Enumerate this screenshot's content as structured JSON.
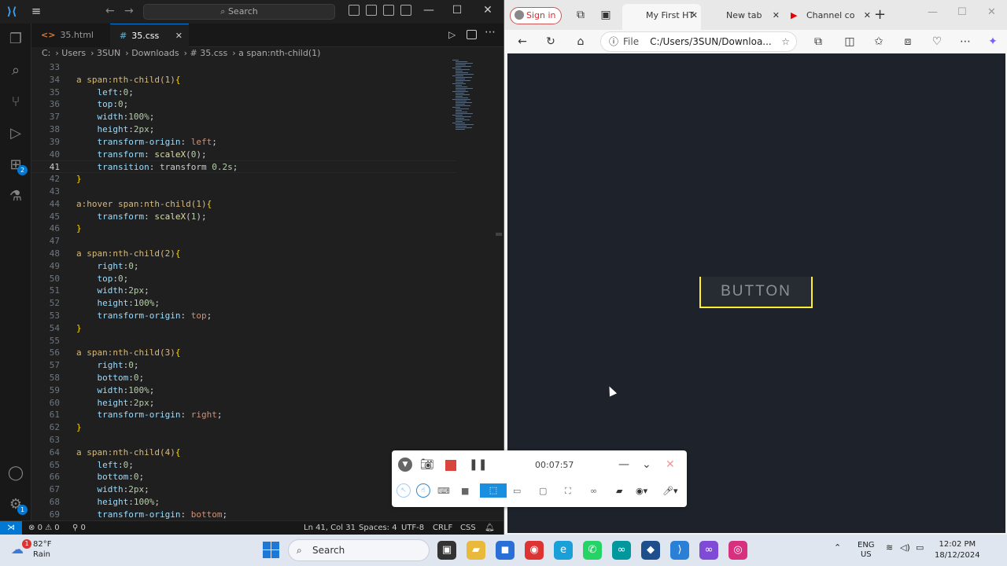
{
  "vscode": {
    "search_placeholder": "Search",
    "tabs": [
      {
        "label": "35.html",
        "icon": "<>"
      },
      {
        "label": "35.css",
        "icon": "#"
      }
    ],
    "breadcrumb": [
      "C:",
      "Users",
      "3SUN",
      "Downloads",
      "# 35.css",
      "a span:nth-child(1)"
    ],
    "lines": [
      {
        "n": "33",
        "t": ""
      },
      {
        "n": "34",
        "t": "a span:nth-child(1){"
      },
      {
        "n": "35",
        "t": "    left:0;"
      },
      {
        "n": "36",
        "t": "    top:0;"
      },
      {
        "n": "37",
        "t": "    width:100%;"
      },
      {
        "n": "38",
        "t": "    height:2px;"
      },
      {
        "n": "39",
        "t": "    transform-origin: left;"
      },
      {
        "n": "40",
        "t": "    transform: scaleX(0);"
      },
      {
        "n": "41",
        "t": "    transition: transform 0.2s;"
      },
      {
        "n": "42",
        "t": "}"
      },
      {
        "n": "43",
        "t": ""
      },
      {
        "n": "44",
        "t": "a:hover span:nth-child(1){"
      },
      {
        "n": "45",
        "t": "    transform: scaleX(1);"
      },
      {
        "n": "46",
        "t": "}"
      },
      {
        "n": "47",
        "t": ""
      },
      {
        "n": "48",
        "t": "a span:nth-child(2){"
      },
      {
        "n": "49",
        "t": "    right:0;"
      },
      {
        "n": "50",
        "t": "    top:0;"
      },
      {
        "n": "51",
        "t": "    width:2px;"
      },
      {
        "n": "52",
        "t": "    height:100%;"
      },
      {
        "n": "53",
        "t": "    transform-origin: top;"
      },
      {
        "n": "54",
        "t": "}"
      },
      {
        "n": "55",
        "t": ""
      },
      {
        "n": "56",
        "t": "a span:nth-child(3){"
      },
      {
        "n": "57",
        "t": "    right:0;"
      },
      {
        "n": "58",
        "t": "    bottom:0;"
      },
      {
        "n": "59",
        "t": "    width:100%;"
      },
      {
        "n": "60",
        "t": "    height:2px;"
      },
      {
        "n": "61",
        "t": "    transform-origin: right;"
      },
      {
        "n": "62",
        "t": "}"
      },
      {
        "n": "63",
        "t": ""
      },
      {
        "n": "64",
        "t": "a span:nth-child(4){"
      },
      {
        "n": "65",
        "t": "    left:0;"
      },
      {
        "n": "66",
        "t": "    bottom:0;"
      },
      {
        "n": "67",
        "t": "    width:2px;"
      },
      {
        "n": "68",
        "t": "    height:100%;"
      },
      {
        "n": "69",
        "t": "    transform-origin: bottom;"
      }
    ],
    "status": {
      "errors": "0",
      "warnings": "0",
      "ports": "0",
      "position": "Ln 41, Col 31",
      "spaces": "Spaces: 4",
      "encoding": "UTF-8",
      "eol": "CRLF",
      "lang": "CSS"
    },
    "ext_badge": "2",
    "settings_badge": "1"
  },
  "browser": {
    "signin": "Sign in",
    "tabs": [
      "My First HT",
      "New tab",
      "Channel co"
    ],
    "address_prefix": "File",
    "address": "C:/Users/3SUN/Downloa...",
    "demo_button": "BUTTON",
    "accent": "#ffee33"
  },
  "recorder": {
    "time": "00:07:57"
  },
  "taskbar": {
    "temp": "82°F",
    "weather": "Rain",
    "weather_badge": "1",
    "search": "Search",
    "lang1": "ENG",
    "lang2": "US",
    "time": "12:02 PM",
    "date": "18/12/2024"
  }
}
